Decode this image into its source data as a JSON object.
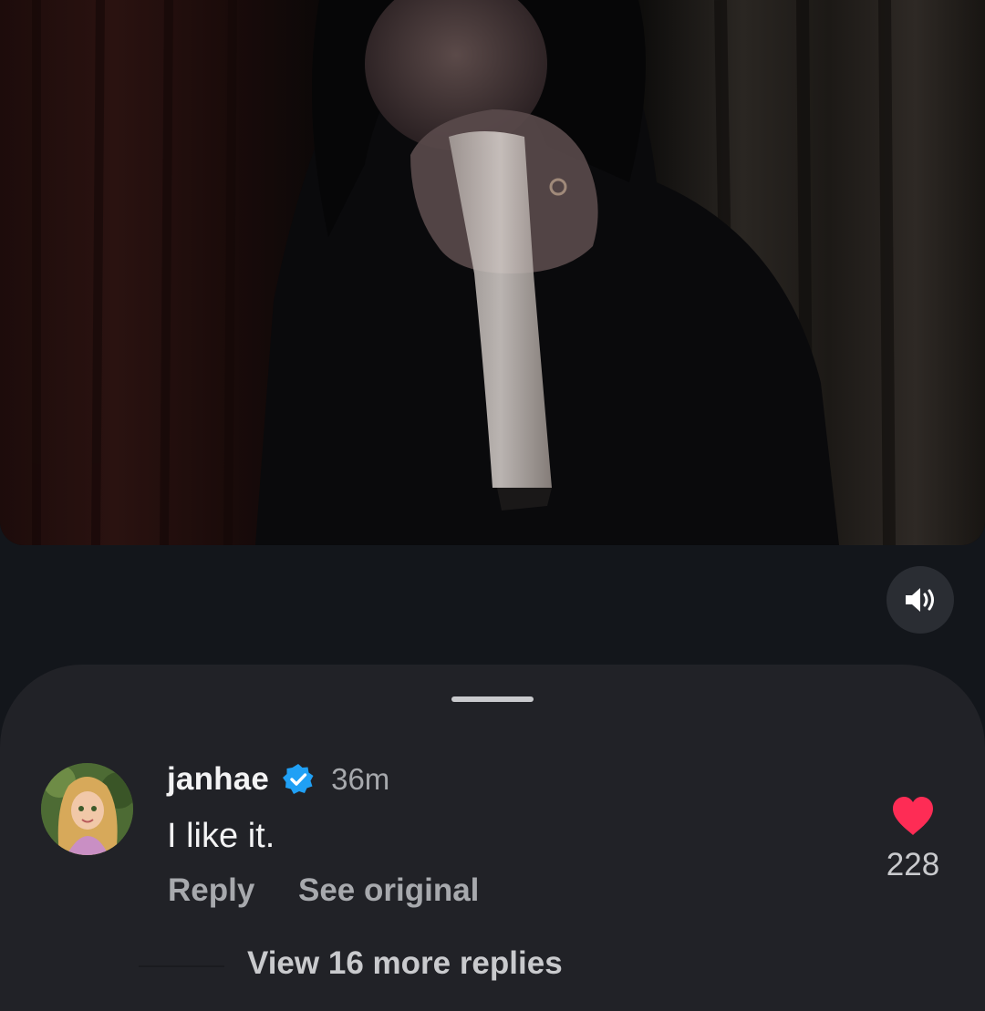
{
  "video": {
    "description_icon": "video-frame",
    "sound_icon": "speaker-on-icon"
  },
  "comment": {
    "username": "janhae",
    "verified_icon": "verified-badge-icon",
    "time": "36m",
    "text": "I like it.",
    "like_icon": "heart-filled-icon",
    "like_count": "228",
    "reply_label": "Reply",
    "see_original_label": "See original",
    "view_replies_label": "View 16 more replies"
  },
  "colors": {
    "background": "#13161b",
    "sheet": "#212227",
    "heart": "#fe2c55",
    "verified": "#20a0f5",
    "muted_text": "#a7a9ad"
  }
}
